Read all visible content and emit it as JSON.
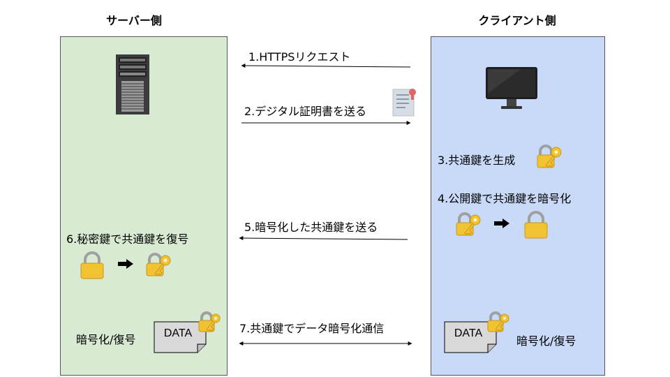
{
  "server": {
    "title": "サーバー側"
  },
  "client": {
    "title": "クライアント側"
  },
  "steps": {
    "s1": "1.HTTPSリクエスト",
    "s2": "2.デジタル証明書を送る",
    "s3": "3.共通鍵を生成",
    "s4": "4.公開鍵で共通鍵を暗号化",
    "s5": "5.暗号化した共通鍵を送る",
    "s6": "6.秘密鍵で共通鍵を復号",
    "s7": "7.共通鍵でデータ暗号化通信"
  },
  "server_crypto_label": "暗号化/復号",
  "client_crypto_label": "暗号化/復号",
  "data_label": "DATA",
  "colors": {
    "server_bg": "#d9ead3",
    "client_bg": "#c9daf8",
    "lock": "#f1c232",
    "key": "#f1c232"
  }
}
